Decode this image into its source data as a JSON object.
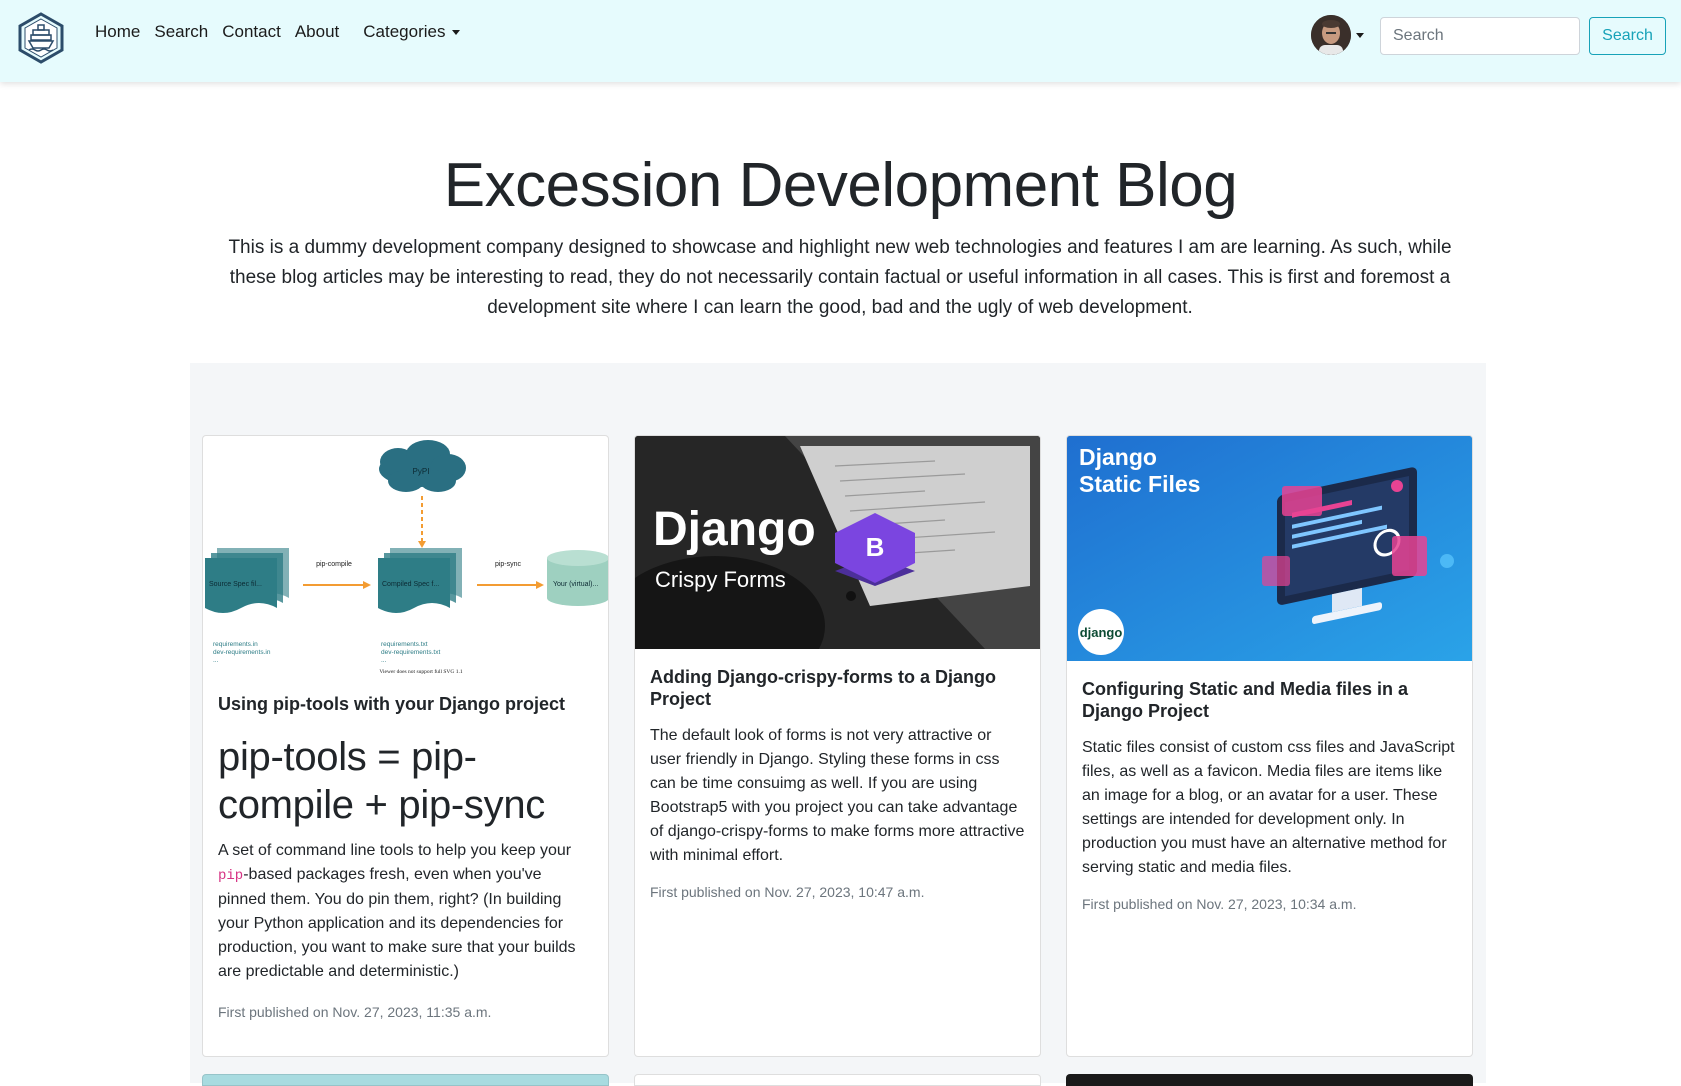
{
  "nav": {
    "links": [
      "Home",
      "Search",
      "Contact",
      "About"
    ],
    "categories_label": "Categories",
    "search_placeholder": "Search",
    "search_button": "Search"
  },
  "hero": {
    "title": "Excession Development Blog",
    "lead_1": "This is a dummy development company designed to showcase and highlight new web ",
    "lead_b1": "technologies",
    "lead_2": " and ",
    "lead_b2": "features",
    "lead_3": " I am are learning. As such, while these blog articles may be interesting to read, they do not necessarily contain factual or useful information in all cases. This is first and foremost a development site where I can learn the good, bad and the ugly of web development."
  },
  "cards": [
    {
      "title": "Using pip-tools with your Django project",
      "heading": "pip-tools = pip-compile + pip-sync",
      "text_1": "A set of command line tools to help you keep your ",
      "code": "pip",
      "text_2": "-based packages fresh, even when you've pinned them. You do pin them, right? (In building your Python application and its dependencies for production, you want to make sure that your builds are predictable and deterministic.)",
      "meta": "First published on Nov. 27, 2023, 11:35 a.m.",
      "diagram": {
        "cloud": "PyPI",
        "arrow1": "pip-compile",
        "arrow2": "pip-sync",
        "doc1": "Source Spec fil...",
        "doc2": "Compiled Spec f...",
        "db": "Your (virtual)...",
        "files1a": "requirements.in",
        "files1b": "dev-requirements.in",
        "files1c": "...",
        "files2a": "requirements.txt",
        "files2b": "dev-requirements.txt",
        "files2c": "...",
        "footer": "Viewer does not support full SVG 1.1"
      }
    },
    {
      "title": "Adding Django-crispy-forms to a Django Project",
      "text": "The default look of forms is not very attractive or user friendly in Django. Styling these forms in css can be time consuimg as well. If you are using Bootstrap5 with you project you can take advantage of django-crispy-forms to make forms more attractive with minimal effort.",
      "meta": "First published on Nov. 27, 2023, 10:47 a.m.",
      "img_title": "Django",
      "img_sub": "Crispy Forms"
    },
    {
      "title": "Configuring Static and Media files in a Django Project",
      "text": "Static files consist of custom css files and JavaScript files, as well as a favicon. Media files are items like an image for a blog, or an avatar for a user. These settings are intended for development only. In production you must have an alternative method for serving static and media files.",
      "meta": "First published on Nov. 27, 2023, 10:34 a.m.",
      "img_title_1": "Django",
      "img_title_2": "Static Files",
      "img_logo": "django"
    }
  ],
  "colors": {
    "navbar_bg": "#e6fbfd",
    "accent": "#17a2b8",
    "teal": "#2e7d86",
    "orange": "#f39c32"
  }
}
